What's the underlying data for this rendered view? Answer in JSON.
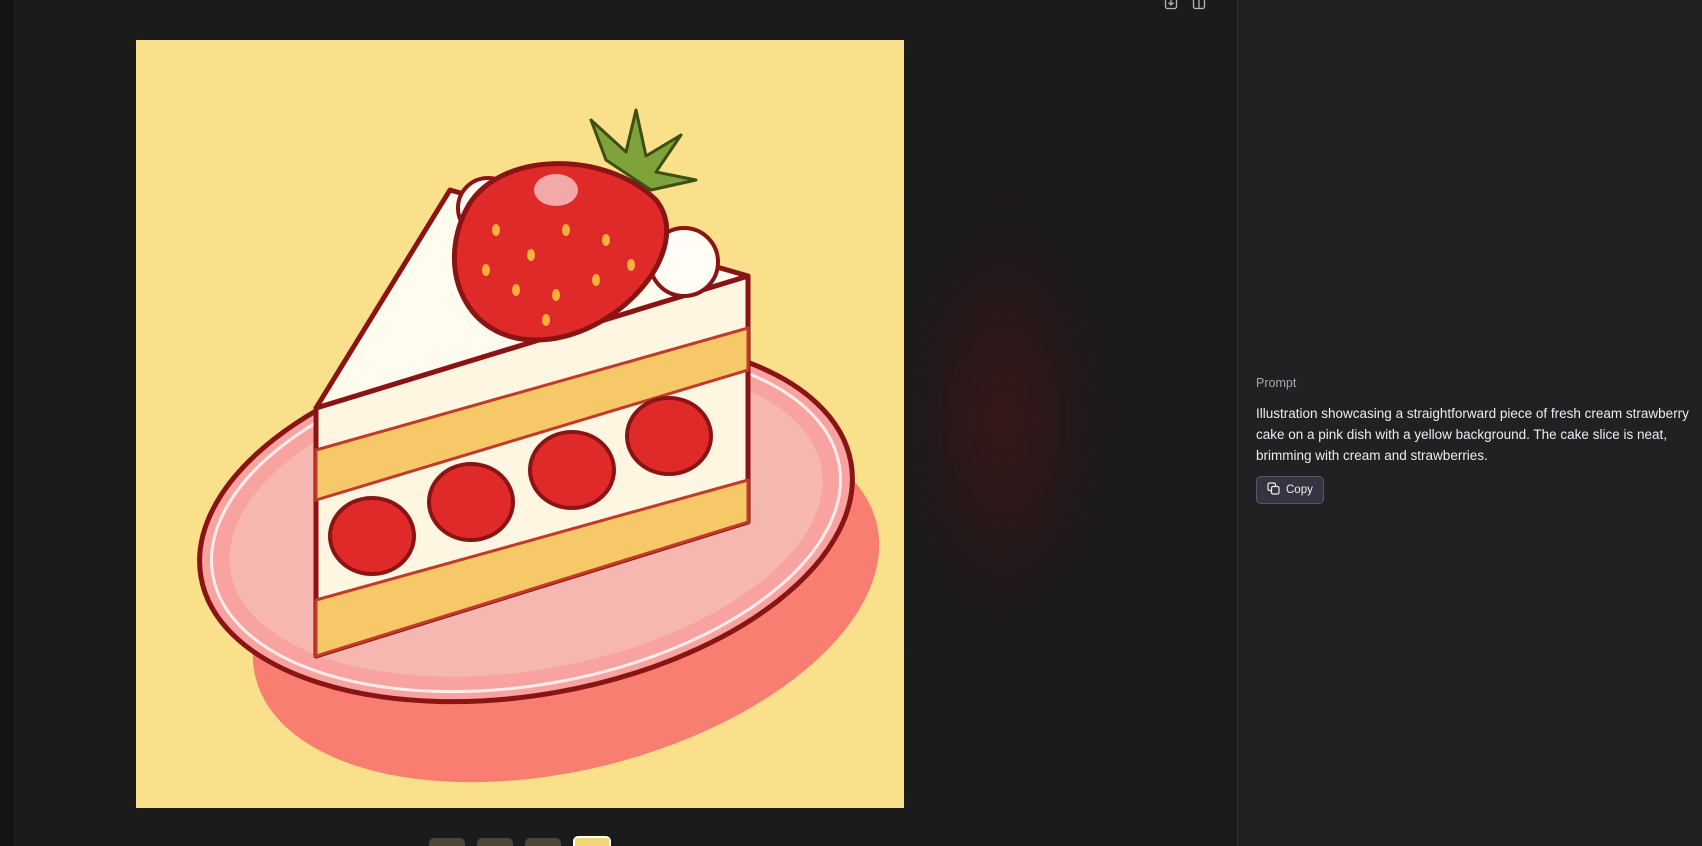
{
  "viewer": {
    "image_alt": "Strawberry cream cake slice on a pink dish",
    "thumbnail_count": 4,
    "active_thumbnail": 4,
    "actions": [
      {
        "name": "download-icon"
      },
      {
        "name": "panel-icon"
      }
    ]
  },
  "panel": {
    "prompt_label": "Prompt",
    "prompt_text": "Illustration showcasing a straightforward piece of fresh cream strawberry cake on a pink dish with a yellow background. The cake slice is neat, brimming with cream and strawberries.",
    "copy_label": "Copy"
  },
  "colors": {
    "background": "#1b1b1c",
    "panel": "#202123",
    "image_background": "#fbe08c",
    "plate": "#f6908a",
    "strawberry": "#e02a2a",
    "outline": "#8a1414"
  }
}
